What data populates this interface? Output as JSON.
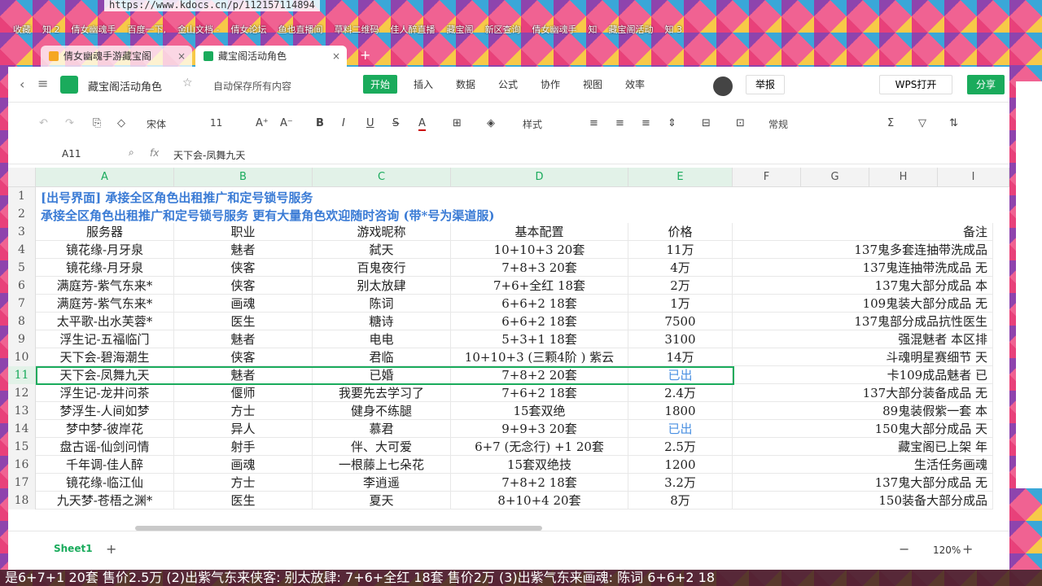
{
  "browser": {
    "url": "https://www.kdocs.cn/p/112157114894",
    "bookmarks": [
      "收藏",
      "知 2",
      "倩女幽魂手",
      "百度一下,",
      "金山文档 -",
      "倩女论坛",
      "鱼也直播间",
      "草料二维码",
      "佳人醉直播",
      "藏宝阁",
      "新区查询",
      "倩女幽魂手",
      "知",
      "藏宝阁活动",
      "知 3"
    ],
    "tabs": [
      {
        "label": "倩女幽魂手游藏宝阁",
        "close": "×"
      },
      {
        "label": "藏宝阁活动角色",
        "close": "×"
      }
    ],
    "new_tab": "+"
  },
  "doc": {
    "title": "藏宝阁活动角色",
    "autosave": "自动保存所有内容",
    "menus": [
      "开始",
      "插入",
      "数据",
      "公式",
      "协作",
      "视图",
      "效率"
    ],
    "report": "举报",
    "wps_open": "WPS打开",
    "share": "分享"
  },
  "toolbar": {
    "font": "宋体",
    "font_size": "11",
    "style": "样式",
    "number_format": "常规"
  },
  "formula_bar": {
    "cell_ref": "A11",
    "fx": "fx",
    "value": "天下会-凤舞九天"
  },
  "columns": [
    "A",
    "B",
    "C",
    "D",
    "E",
    "F",
    "G",
    "H",
    "I"
  ],
  "rows_num": [
    "1",
    "2",
    "3",
    "4",
    "5",
    "6",
    "7",
    "8",
    "9",
    "10",
    "11",
    "12",
    "13",
    "14",
    "15",
    "16",
    "17",
    "18"
  ],
  "banner": {
    "row1": "[出号界面] 承接全区角色出租推广和定号锁号服务",
    "row2": "承接全区角色出租推广和定号锁号服务 更有大量角色欢迎随时咨询 (带*号为渠道服)"
  },
  "header": [
    "服务器",
    "职业",
    "游戏昵称",
    "基本配置",
    "价格",
    "备注"
  ],
  "rows": [
    {
      "a": "镜花缘-月牙泉",
      "b": "魅者",
      "c": "弑天",
      "d": "10+10+3 20套",
      "e": "11万",
      "note": "137鬼多套连抽带洗成品"
    },
    {
      "a": "镜花缘-月牙泉",
      "b": "侠客",
      "c": "百鬼夜行",
      "d": "7+8+3 20套",
      "e": "4万",
      "note": "137鬼连抽带洗成品 无"
    },
    {
      "a": "满庭芳-紫气东来*",
      "b": "侠客",
      "c": "别太放肆",
      "d": "7+6+全红 18套",
      "e": "2万",
      "note": "137鬼大部分成品 本"
    },
    {
      "a": "满庭芳-紫气东来*",
      "b": "画魂",
      "c": "陈词",
      "d": "6+6+2 18套",
      "e": "1万",
      "note": "109鬼装大部分成品 无"
    },
    {
      "a": "太平歌-出水芙蓉*",
      "b": "医生",
      "c": "糖诗",
      "d": "6+6+2 18套",
      "e": "7500",
      "note": "137鬼部分成品抗性医生"
    },
    {
      "a": "浮生记-五福临门",
      "b": "魅者",
      "c": "电电",
      "d": "5+3+1 18套",
      "e": "3100",
      "note": "强混魅者 本区排"
    },
    {
      "a": "天下会-碧海潮生",
      "b": "侠客",
      "c": "君临",
      "d": "10+10+3 (三颗4阶 ) 紫云",
      "e": "14万",
      "note": "斗魂明星赛细节 天"
    },
    {
      "a": "天下会-凤舞九天",
      "b": "魅者",
      "c": "已婚",
      "d": "7+8+2 20套",
      "e": "已出",
      "note": "卡109成品魅者 已"
    },
    {
      "a": "浮生记-龙井问茶",
      "b": "偃师",
      "c": "我要先去学习了",
      "d": "7+6+2 18套",
      "e": "2.4万",
      "note": "137大部分装备成品 无"
    },
    {
      "a": "梦浮生-人间如梦",
      "b": "方士",
      "c": "健身不练腿",
      "d": "15套双绝",
      "e": "1800",
      "note": "89鬼装假紫一套 本"
    },
    {
      "a": "梦中梦-彼岸花",
      "b": "异人",
      "c": "慕君",
      "d": "9+9+3 20套",
      "e": "已出",
      "note": "150鬼大部分成品 天"
    },
    {
      "a": "盘古谣-仙剑问情",
      "b": "射手",
      "c": "伴、大可爱",
      "d": "6+7 (无念行) +1 20套",
      "e": "2.5万",
      "note": "藏宝阁已上架 年"
    },
    {
      "a": "千年调-佳人醉",
      "b": "画魂",
      "c": "一根藤上七朵花",
      "d": "15套双绝技",
      "e": "1200",
      "note": "生活任务画魂"
    },
    {
      "a": "镜花缘-临江仙",
      "b": "方士",
      "c": "李逍遥",
      "d": "7+8+2 18套",
      "e": "3.2万",
      "note": "137鬼大部分成品 无"
    },
    {
      "a": "九天梦-苍梧之渊*",
      "b": "医生",
      "c": "夏天",
      "d": "8+10+4 20套",
      "e": "8万",
      "note": "150装备大部分成品"
    }
  ],
  "sheet_tab": "Sheet1",
  "zoom": "120%",
  "ticker": "是6+7+1 20套 售价2.5万 (2)出紫气东来侠客: 别太放肆: 7+6+全红 18套 售价2万 (3)出紫气东来画魂: 陈词 6+6+2 18"
}
